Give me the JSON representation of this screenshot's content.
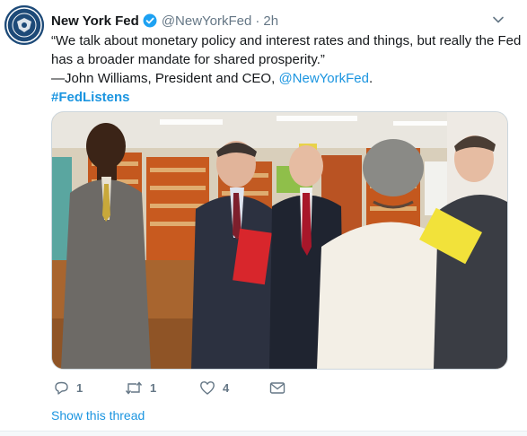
{
  "tweet": {
    "author_name": "New York Fed",
    "handle": "@NewYorkFed",
    "separator": "·",
    "time": "2h",
    "verified_icon": "verified-badge-icon",
    "text_lines": [
      "“We talk about monetary policy and interest rates and things, but really the Fed",
      "has a broader mandate for shared prosperity.”"
    ],
    "attribution_prefix": "—John Williams, President and CEO, ",
    "attribution_mention": "@NewYorkFed",
    "attribution_suffix": ".",
    "hashtag": "#FedListens"
  },
  "actions": {
    "reply_count": "1",
    "retweet_count": "1",
    "like_count": "4"
  },
  "thread": {
    "label": "Show this thread"
  },
  "colors": {
    "link": "#1b95e0",
    "muted": "#657786",
    "text": "#14171a"
  }
}
